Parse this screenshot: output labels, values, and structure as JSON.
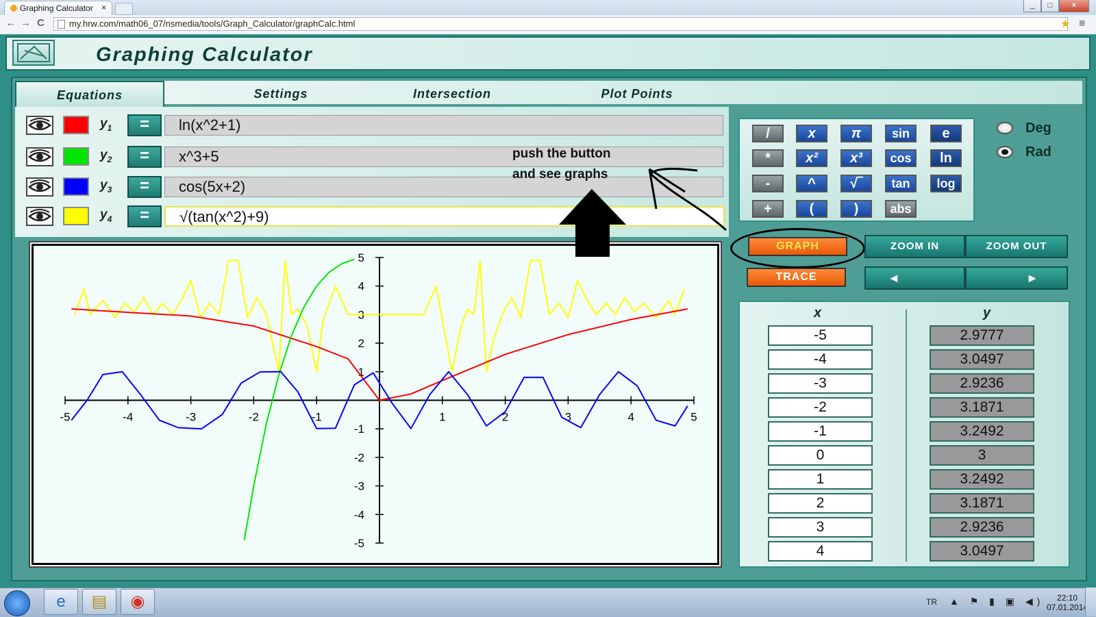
{
  "browser": {
    "tab_title": "Graphing Calculator",
    "tab_close": "×",
    "url": "my.hrw.com/math06_07/nsmedia/tools/Graph_Calculator/graphCalc.html",
    "nav_back": "←",
    "nav_forward": "→",
    "nav_reload": "C",
    "star": "★",
    "menu": "≡",
    "win_min": "_",
    "win_max": "□",
    "win_close": "×"
  },
  "app": {
    "title": "Graphing Calculator",
    "tabs": [
      "Equations",
      "Settings",
      "Intersection",
      "Plot Points"
    ]
  },
  "equations": [
    {
      "label": "y",
      "sub": "1",
      "color": "#ff0000",
      "expr": "ln(x^2+1)"
    },
    {
      "label": "y",
      "sub": "2",
      "color": "#00e600",
      "expr": "x^3+5"
    },
    {
      "label": "y",
      "sub": "3",
      "color": "#0000ff",
      "expr": "cos(5x+2)"
    },
    {
      "label": "y",
      "sub": "4",
      "color": "#ffff00",
      "expr": "√(tan(x^2)+9)"
    }
  ],
  "equals_label": "=",
  "hint": {
    "line1": "push the button",
    "line2": "and see graphs"
  },
  "keypad": {
    "rows": [
      [
        {
          "t": "/",
          "s": "gray"
        },
        {
          "t": "x",
          "s": "blue"
        },
        {
          "t": "π",
          "s": "blue"
        },
        {
          "t": "sin",
          "s": "blue fn"
        },
        {
          "t": "e",
          "s": "navy"
        }
      ],
      [
        {
          "t": "*",
          "s": "gray"
        },
        {
          "t": "x²",
          "s": "blue"
        },
        {
          "t": "x³",
          "s": "blue"
        },
        {
          "t": "cos",
          "s": "blue fn"
        },
        {
          "t": "ln",
          "s": "navy"
        }
      ],
      [
        {
          "t": "-",
          "s": "gray"
        },
        {
          "t": "^",
          "s": "blue fn"
        },
        {
          "t": "√‾",
          "s": "blue fn"
        },
        {
          "t": "tan",
          "s": "blue fn"
        },
        {
          "t": "log",
          "s": "navy"
        }
      ],
      [
        {
          "t": "+",
          "s": "gray"
        },
        {
          "t": "(",
          "s": "blue fn"
        },
        {
          "t": ")",
          "s": "blue fn"
        },
        {
          "t": "abs",
          "s": "gray"
        }
      ]
    ]
  },
  "angle_mode": {
    "deg": "Deg",
    "rad": "Rad",
    "selected": "Rad"
  },
  "buttons": {
    "graph": "GRAPH",
    "trace": "TRACE",
    "zoom_in": "ZOOM IN",
    "zoom_out": "ZOOM OUT",
    "left": "◄",
    "right": "►"
  },
  "table": {
    "x_header": "x",
    "y_header": "y",
    "x": [
      "-5",
      "-4",
      "-3",
      "-2",
      "-1",
      "0",
      "1",
      "2",
      "3",
      "4"
    ],
    "y": [
      "2.9777",
      "3.0497",
      "2.9236",
      "3.1871",
      "3.2492",
      "3",
      "3.2492",
      "3.1871",
      "2.9236",
      "3.0497"
    ]
  },
  "chart_data": {
    "type": "line",
    "xlim": [
      -5,
      5
    ],
    "ylim": [
      -5,
      5
    ],
    "xticks": [
      -5,
      -4,
      -3,
      -2,
      -1,
      1,
      2,
      3,
      4,
      5
    ],
    "yticks": [
      -5,
      -4,
      -3,
      -2,
      -1,
      1,
      2,
      3,
      4,
      5
    ],
    "grid": false,
    "series": [
      {
        "color": "#ff0000",
        "x": [
          -4.9,
          -4,
          -3,
          -2,
          -1,
          -0.5,
          0,
          0.5,
          1,
          2,
          3,
          4,
          4.9
        ],
        "y": [
          3.2,
          3.08,
          2.95,
          2.6,
          1.88,
          1.45,
          0,
          0.22,
          0.69,
          1.61,
          2.3,
          2.83,
          3.2
        ]
      },
      {
        "color": "#00e600",
        "x": [
          -2.15,
          -2,
          -1.8,
          -1.6,
          -1.4,
          -1.2,
          -1,
          -0.8,
          -0.6,
          -0.4
        ],
        "y": [
          -4.9,
          -3,
          -0.83,
          0.9,
          2.26,
          3.27,
          4,
          4.49,
          4.78,
          4.94
        ]
      },
      {
        "color": "#0000ff",
        "x": [
          -4.9,
          -4.65,
          -4.4,
          -4.09,
          -3.8,
          -3.5,
          -3.2,
          -2.83,
          -2.5,
          -2.2,
          -1.9,
          -1.57,
          -1.3,
          -1,
          -0.7,
          -0.4,
          -0.1,
          0.2,
          0.5,
          0.8,
          1.1,
          1.4,
          1.7,
          2.0,
          2.3,
          2.6,
          2.9,
          3.2,
          3.5,
          3.8,
          4.1,
          4.4,
          4.7,
          4.9
        ],
        "y": [
          -0.7,
          0,
          0.9,
          1,
          0.2,
          -0.7,
          -0.96,
          -1,
          -0.5,
          0.6,
          0.99,
          1,
          0.3,
          -0.99,
          -0.98,
          0.54,
          0.96,
          -0.1,
          -0.99,
          0.2,
          1,
          0.2,
          -0.9,
          -0.4,
          0.8,
          0.8,
          -0.6,
          -0.96,
          0.2,
          1,
          0.5,
          -0.7,
          -0.9,
          -0.2
        ]
      },
      {
        "color": "#ffff00",
        "x": [
          -4.85,
          -4.7,
          -4.6,
          -4.4,
          -4.2,
          -4.05,
          -3.9,
          -3.75,
          -3.6,
          -3.45,
          -3.3,
          -3.15,
          -3.0,
          -2.85,
          -2.7,
          -2.55,
          -2.4,
          -2.25,
          -2.1,
          -1.95,
          -1.8,
          -1.7,
          -1.6,
          -1.5,
          -1.4,
          -1.3,
          -1.15,
          -1.0,
          -0.9,
          -0.7,
          -0.5,
          -0.3,
          0,
          0.3,
          0.5,
          0.7,
          0.9,
          1.0,
          1.15,
          1.3,
          1.4,
          1.5,
          1.6,
          1.7,
          1.8,
          1.95,
          2.1,
          2.25,
          2.4,
          2.55,
          2.7,
          2.85,
          3.0,
          3.15,
          3.3,
          3.45,
          3.6,
          3.75,
          3.9,
          4.05,
          4.2,
          4.4,
          4.6,
          4.7,
          4.85
        ],
        "y": [
          2.98,
          3.9,
          3.0,
          3.5,
          2.9,
          3.4,
          3.1,
          3.6,
          3.0,
          3.4,
          3.0,
          3.5,
          4.2,
          2.9,
          3.4,
          3.0,
          4.9,
          4.9,
          2.9,
          3.6,
          3.0,
          2.0,
          1.0,
          4.9,
          3.0,
          3.2,
          2.6,
          1.0,
          2.8,
          4.0,
          3.0,
          3.0,
          3.0,
          3.0,
          3.0,
          3.0,
          4.0,
          2.8,
          1.0,
          2.6,
          3.2,
          3.0,
          4.9,
          1.0,
          2.0,
          3.0,
          3.6,
          2.9,
          4.9,
          4.9,
          3.0,
          3.4,
          2.9,
          4.2,
          3.5,
          3.0,
          3.4,
          3.0,
          3.6,
          3.1,
          3.4,
          2.9,
          3.5,
          3.0,
          3.9
        ]
      }
    ]
  },
  "taskbar": {
    "apps": [
      "e",
      "▤",
      "◉"
    ],
    "lang": "TR",
    "tray": "▲ ⚑ ▮ ▣ ◀)",
    "time": "22:10",
    "date": "07.01.2014"
  }
}
